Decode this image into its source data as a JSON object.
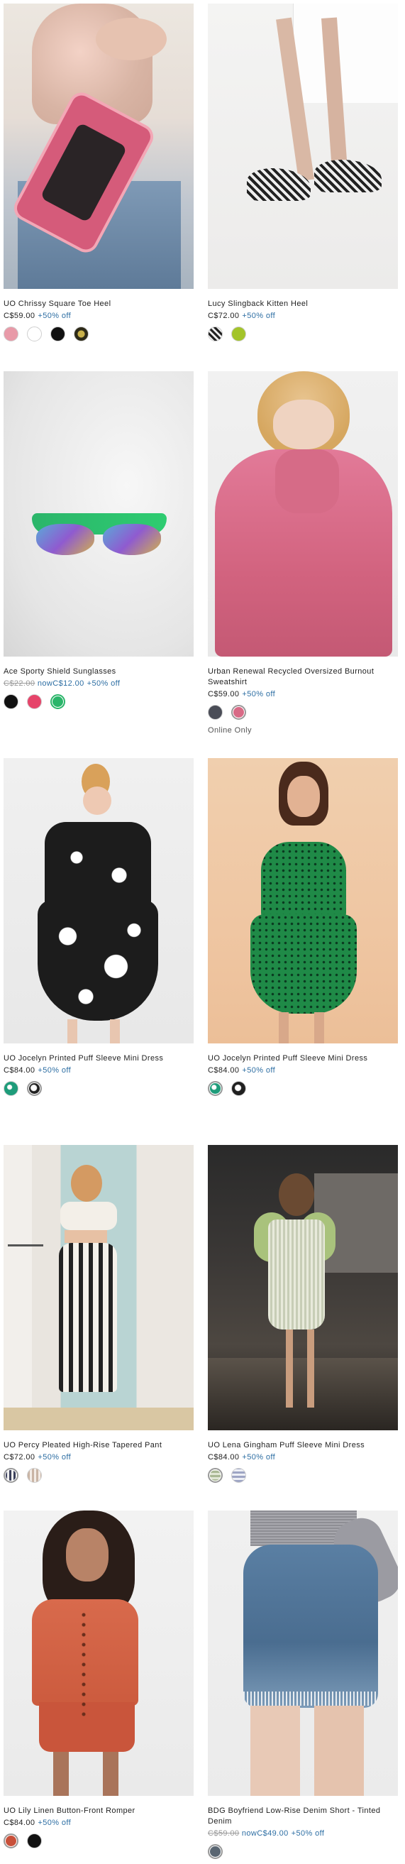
{
  "products": [
    {
      "name": "UO Chrissy Square Toe Heel",
      "price": "C$59.00",
      "sale_prefix": "",
      "was_price": "",
      "off": "+50% off",
      "image": "pink-heel-photo",
      "swatches": [
        {
          "name": "pink",
          "color": "#e89aa8"
        },
        {
          "name": "white",
          "color": "#ffffff"
        },
        {
          "name": "black",
          "color": "#111111"
        },
        {
          "name": "gold",
          "color": "#4a4320"
        }
      ]
    },
    {
      "name": "Lucy Slingback Kitten Heel",
      "price": "C$72.00",
      "sale_prefix": "",
      "was_price": "",
      "off": "+50% off",
      "image": "slingback-heel-photo",
      "swatches": [
        {
          "name": "checker",
          "color": "#3b3b3b"
        },
        {
          "name": "lime",
          "color": "#a3c42a"
        }
      ]
    },
    {
      "name": "Ace Sporty Shield Sunglasses",
      "price": "",
      "sale_prefix": "now",
      "was_price": "C$22.00",
      "now_price": "C$12.00",
      "off": "+50% off",
      "image": "sunglasses-photo",
      "swatches": [
        {
          "name": "black",
          "color": "#111111"
        },
        {
          "name": "pink",
          "color": "#e6446a"
        },
        {
          "name": "green",
          "color": "#2bb56a"
        }
      ]
    },
    {
      "name": "Urban Renewal Recycled Oversized Burnout Sweatshirt",
      "price": "C$59.00",
      "sale_prefix": "",
      "was_price": "",
      "off": "+50% off",
      "image": "pink-sweatshirt-photo",
      "badge": "Online Only",
      "swatches": [
        {
          "name": "charcoal",
          "color": "#4a4d57"
        },
        {
          "name": "pink",
          "color": "#d86a86"
        }
      ]
    },
    {
      "name": "UO Jocelyn Printed Puff Sleeve Mini Dress",
      "price": "C$84.00",
      "sale_prefix": "",
      "was_price": "",
      "off": "+50% off",
      "image": "black-floral-dress-photo",
      "swatches": [
        {
          "name": "green-print",
          "color": "#1e9c7a"
        },
        {
          "name": "black-print",
          "color": "#202020"
        }
      ]
    },
    {
      "name": "UO Jocelyn Printed Puff Sleeve Mini Dress",
      "price": "C$84.00",
      "sale_prefix": "",
      "was_price": "",
      "off": "+50% off",
      "image": "green-dot-dress-photo",
      "swatches": [
        {
          "name": "green-print",
          "color": "#1e9c7a"
        },
        {
          "name": "black-print",
          "color": "#202020"
        }
      ]
    },
    {
      "name": "UO Percy Pleated High-Rise Tapered Pant",
      "price": "C$72.00",
      "sale_prefix": "",
      "was_price": "",
      "off": "+50% off",
      "image": "striped-pant-photo",
      "swatches": [
        {
          "name": "navy-stripe",
          "color": "#3a3f5a"
        },
        {
          "name": "cream-stripe",
          "color": "#d9cfc6"
        }
      ]
    },
    {
      "name": "UO Lena Gingham Puff Sleeve Mini Dress",
      "price": "C$84.00",
      "sale_prefix": "",
      "was_price": "",
      "off": "+50% off",
      "image": "gingham-dress-photo",
      "swatches": [
        {
          "name": "green-gingham",
          "color": "#b5c3a0"
        },
        {
          "name": "blue-gingham",
          "color": "#c3c7d8"
        }
      ]
    },
    {
      "name": "UO Lily Linen Button-Front Romper",
      "price": "C$84.00",
      "sale_prefix": "",
      "was_price": "",
      "off": "+50% off",
      "image": "rust-romper-photo",
      "swatches": [
        {
          "name": "rust",
          "color": "#c8503a"
        },
        {
          "name": "black",
          "color": "#111111"
        }
      ]
    },
    {
      "name": "BDG Boyfriend Low-Rise Denim Short - Tinted Denim",
      "price": "",
      "sale_prefix": "now",
      "was_price": "C$59.00",
      "now_price": "C$49.00",
      "off": "+50% off",
      "image": "denim-short-photo",
      "swatches": [
        {
          "name": "tinted-denim",
          "color": "#5a6672"
        }
      ]
    }
  ]
}
